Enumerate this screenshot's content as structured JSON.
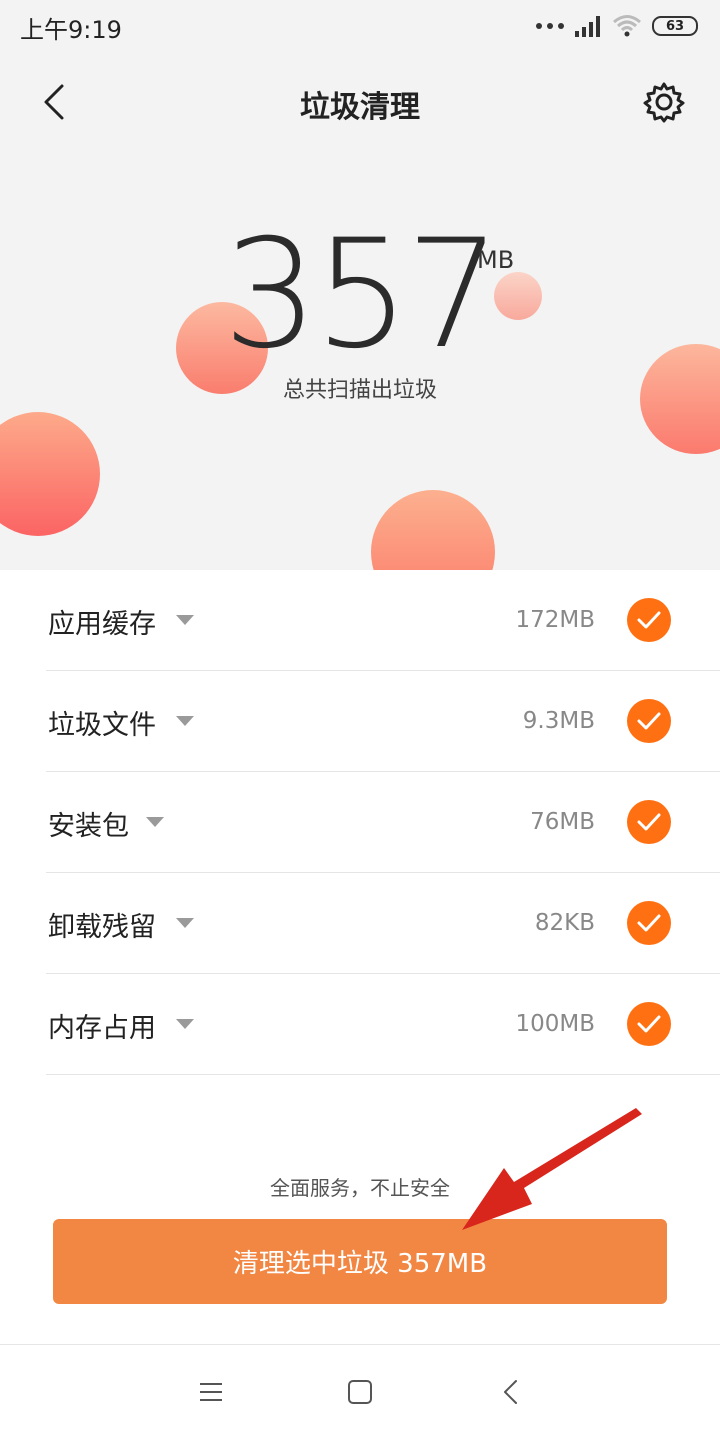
{
  "status_bar": {
    "time": "上午9:19",
    "battery": "63"
  },
  "header": {
    "title": "垃圾清理"
  },
  "summary": {
    "amount": "357",
    "unit": "MB",
    "label": "总共扫描出垃圾"
  },
  "items": [
    {
      "label": "应用缓存",
      "size": "172MB",
      "checked": true
    },
    {
      "label": "垃圾文件",
      "size": "9.3MB",
      "checked": true
    },
    {
      "label": "安装包",
      "size": "76MB",
      "checked": true
    },
    {
      "label": "卸载残留",
      "size": "82KB",
      "checked": true
    },
    {
      "label": "内存占用",
      "size": "100MB",
      "checked": true
    }
  ],
  "footer": {
    "slogan": "全面服务，不止安全",
    "clean_button": "清理选中垃圾 357MB"
  },
  "colors": {
    "accent": "#ff7012",
    "button": "#f28744",
    "arrow": "#d9261c"
  }
}
